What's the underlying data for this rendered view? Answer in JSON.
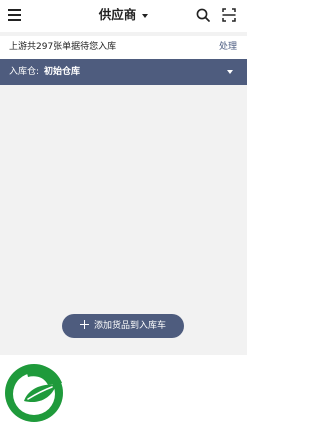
{
  "header": {
    "title": "供应商",
    "menu_icon": "menu-icon",
    "search_icon": "search-icon",
    "scan_icon": "scan-icon"
  },
  "notice": {
    "text": "上游共297张单据待您入库",
    "action": "处理"
  },
  "warehouse": {
    "label": "入库仓:",
    "value": "初始仓库"
  },
  "add_button": {
    "label": "添加货品到入库车"
  },
  "colors": {
    "accent": "#4e5c7e",
    "background": "#f2f2f2",
    "logo_green": "#1f9a3b"
  }
}
